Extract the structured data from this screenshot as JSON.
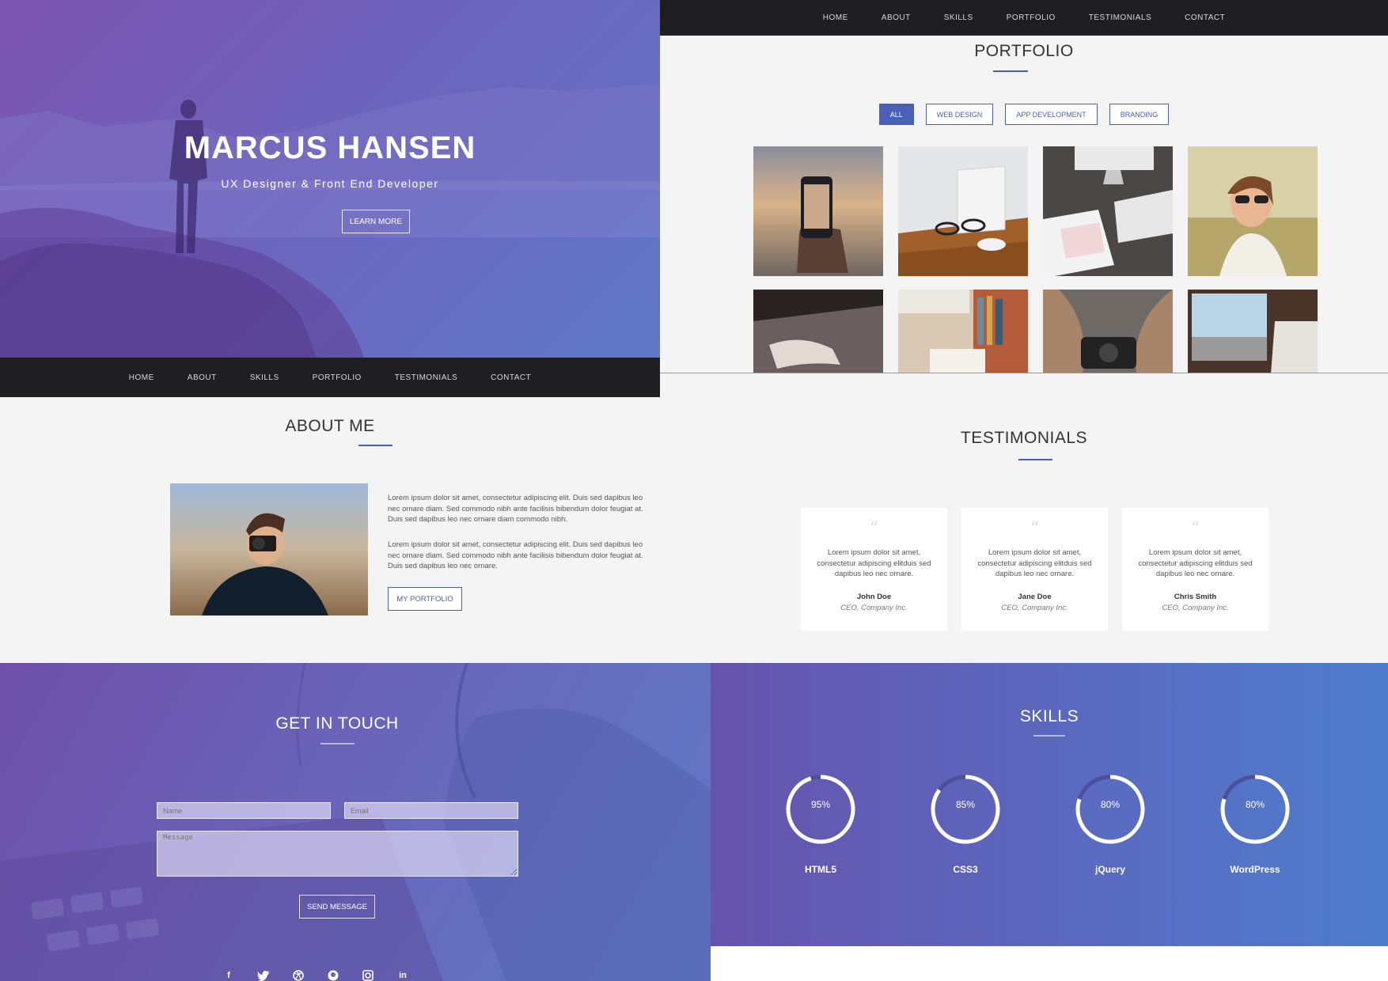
{
  "colors": {
    "accent": "#4a5fb8",
    "nav_bg": "#1f1f21",
    "gradient_start": "#7b55b0",
    "gradient_end": "#5f78c8"
  },
  "hero": {
    "name": "MARCUS HANSEN",
    "subtitle": "UX Designer & Front End Developer",
    "button": "LEARN MORE",
    "nav": [
      "HOME",
      "ABOUT",
      "SKILLS",
      "PORTFOLIO",
      "TESTIMONIALS",
      "CONTACT"
    ]
  },
  "portfolio": {
    "nav": [
      "HOME",
      "ABOUT",
      "SKILLS",
      "PORTFOLIO",
      "TESTIMONIALS",
      "CONTACT"
    ],
    "title": "PORTFOLIO",
    "filters": [
      "ALL",
      "WEB DESIGN",
      "APP DEVELOPMENT",
      "BRANDING"
    ],
    "active_filter": "ALL",
    "thumbnails": [
      "smartphone-photo",
      "desk-glasses-photo",
      "imac-keyboard-photo",
      "woman-sunglasses-photo",
      "laptop-typing-photo",
      "bookshelf-photo",
      "camera-hands-photo",
      "laptop-desk-photo"
    ]
  },
  "about": {
    "title": "ABOUT ME",
    "paragraph1": "Lorem ipsum dolor sit amet, consectetur adipiscing elit. Duis sed dapibus leo nec ornare diam. Sed commodo nibh ante facilisis bibendum dolor feugiat at. Duis sed dapibus leo nec ornare diam commodo nibh.",
    "paragraph2": "Lorem ipsum dolor sit amet, consectetur adipiscing elit. Duis sed dapibus leo nec ornare diam. Sed commodo nibh ante facilisis bibendum dolor feugiat at. Duis sed dapibus leo nec ornare.",
    "button": "MY PORTFOLIO"
  },
  "testimonials": {
    "title": "TESTIMONIALS",
    "items": [
      {
        "quote": "Lorem ipsum dolor sit amet, consectetur adipiscing elitduis sed dapibus leo nec ornare.",
        "name": "John Doe",
        "role": "CEO, Company Inc."
      },
      {
        "quote": "Lorem ipsum dolor sit amet, consectetur adipiscing elitduis sed dapibus leo nec ornare.",
        "name": "Jane Doe",
        "role": "CEO, Company Inc."
      },
      {
        "quote": "Lorem ipsum dolor sit amet, consectetur adipiscing elitduis sed dapibus leo nec ornare.",
        "name": "Chris Smith",
        "role": "CEO, Company Inc."
      }
    ]
  },
  "contact": {
    "title": "GET IN TOUCH",
    "name_placeholder": "Name",
    "email_placeholder": "Email",
    "message_placeholder": "Message",
    "button": "SEND MESSAGE",
    "socials": [
      "facebook-icon",
      "twitter-icon",
      "dribbble-icon",
      "github-icon",
      "instagram-icon",
      "linkedin-icon"
    ]
  },
  "skills": {
    "title": "SKILLS",
    "items": [
      {
        "name": "HTML5",
        "percent": 95,
        "label": "95%"
      },
      {
        "name": "CSS3",
        "percent": 85,
        "label": "85%"
      },
      {
        "name": "jQuery",
        "percent": 80,
        "label": "80%"
      },
      {
        "name": "WordPress",
        "percent": 80,
        "label": "80%"
      }
    ]
  }
}
